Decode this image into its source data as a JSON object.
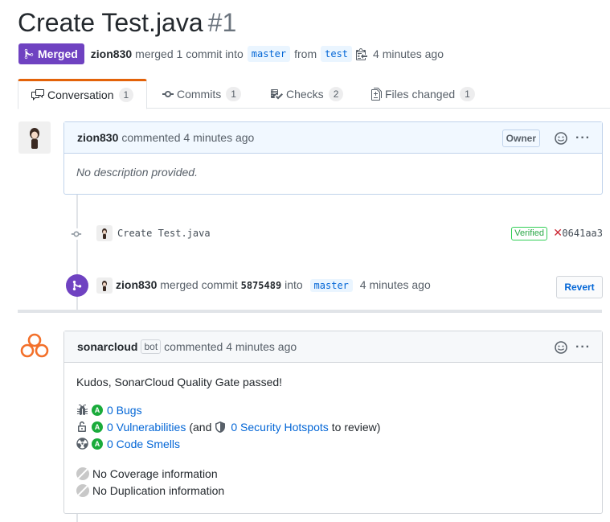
{
  "pr": {
    "title": "Create Test.java",
    "number": "#1",
    "state": "Merged",
    "author": "zion830",
    "merge_text": "merged 1 commit into",
    "base_branch": "master",
    "from_text": "from",
    "head_branch": "test",
    "time": "4 minutes ago"
  },
  "tabs": [
    {
      "label": "Conversation",
      "count": "1"
    },
    {
      "label": "Commits",
      "count": "1"
    },
    {
      "label": "Checks",
      "count": "2"
    },
    {
      "label": "Files changed",
      "count": "1"
    }
  ],
  "comment1": {
    "author": "zion830",
    "action": "commented 4 minutes ago",
    "role": "Owner",
    "body": "No description provided."
  },
  "commit": {
    "message": "Create Test.java",
    "verified": "Verified",
    "sha": "0641aa3"
  },
  "merge_event": {
    "author": "zion830",
    "text1": "merged commit",
    "sha": "5875489",
    "text2": "into",
    "branch": "master",
    "time": "4 minutes ago",
    "revert_label": "Revert"
  },
  "comment2": {
    "author": "sonarcloud",
    "bot_label": "bot",
    "action": "commented 4 minutes ago",
    "heading": "Kudos, SonarCloud Quality Gate passed!",
    "bugs": {
      "grade": "A",
      "link": "0 Bugs"
    },
    "vulns": {
      "grade": "A",
      "link": "0 Vulnerabilities",
      "pre": "(and",
      "hotspots": "0 Security Hotspots",
      "post": "to review)"
    },
    "smells": {
      "grade": "A",
      "link": "0 Code Smells"
    },
    "coverage": "No Coverage information",
    "duplication": "No Duplication information"
  },
  "colors": {
    "merged": "#6f42c1",
    "link": "#0366d6",
    "grade_a": "#1aab3b",
    "sonar": "#f3702a"
  }
}
